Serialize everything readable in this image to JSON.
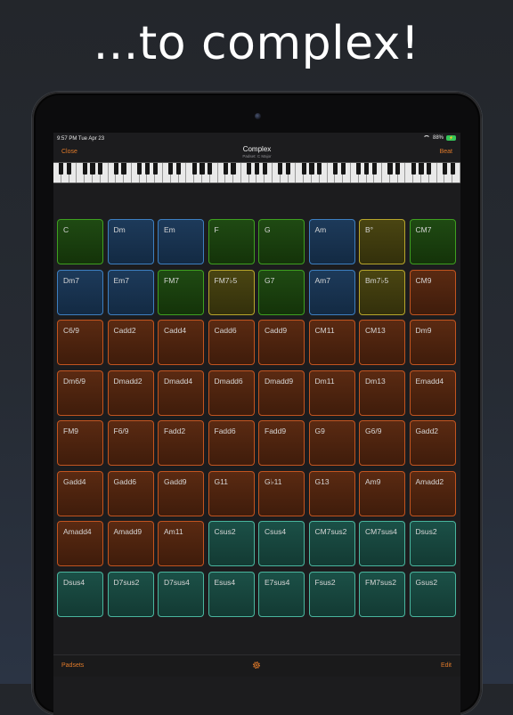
{
  "headline": "...to complex!",
  "status": {
    "time": "9:57 PM  Tue Apr 23",
    "battery": "88%"
  },
  "nav": {
    "left": "Close",
    "title": "Complex",
    "subtitle": "Padset: C Major",
    "right": "Beat"
  },
  "pads": [
    {
      "label": "C",
      "color": "green"
    },
    {
      "label": "Dm",
      "color": "blue"
    },
    {
      "label": "Em",
      "color": "blue"
    },
    {
      "label": "F",
      "color": "green"
    },
    {
      "label": "G",
      "color": "green"
    },
    {
      "label": "Am",
      "color": "blue"
    },
    {
      "label": "B°",
      "color": "yellow"
    },
    {
      "label": "CM7",
      "color": "green"
    },
    {
      "label": "Dm7",
      "color": "blue"
    },
    {
      "label": "Em7",
      "color": "blue"
    },
    {
      "label": "FM7",
      "color": "green"
    },
    {
      "label": "FM7♭5",
      "color": "yellow"
    },
    {
      "label": "G7",
      "color": "green"
    },
    {
      "label": "Am7",
      "color": "blue"
    },
    {
      "label": "Bm7♭5",
      "color": "yellow"
    },
    {
      "label": "CM9",
      "color": "orange"
    },
    {
      "label": "C6/9",
      "color": "orange"
    },
    {
      "label": "Cadd2",
      "color": "orange"
    },
    {
      "label": "Cadd4",
      "color": "orange"
    },
    {
      "label": "Cadd6",
      "color": "orange"
    },
    {
      "label": "Cadd9",
      "color": "orange"
    },
    {
      "label": "CM11",
      "color": "orange"
    },
    {
      "label": "CM13",
      "color": "orange"
    },
    {
      "label": "Dm9",
      "color": "orange"
    },
    {
      "label": "Dm6/9",
      "color": "orange"
    },
    {
      "label": "Dmadd2",
      "color": "orange"
    },
    {
      "label": "Dmadd4",
      "color": "orange"
    },
    {
      "label": "Dmadd6",
      "color": "orange"
    },
    {
      "label": "Dmadd9",
      "color": "orange"
    },
    {
      "label": "Dm11",
      "color": "orange"
    },
    {
      "label": "Dm13",
      "color": "orange"
    },
    {
      "label": "Emadd4",
      "color": "orange"
    },
    {
      "label": "FM9",
      "color": "orange"
    },
    {
      "label": "F6/9",
      "color": "orange"
    },
    {
      "label": "Fadd2",
      "color": "orange"
    },
    {
      "label": "Fadd6",
      "color": "orange"
    },
    {
      "label": "Fadd9",
      "color": "orange"
    },
    {
      "label": "G9",
      "color": "orange"
    },
    {
      "label": "G6/9",
      "color": "orange"
    },
    {
      "label": "Gadd2",
      "color": "orange"
    },
    {
      "label": "Gadd4",
      "color": "orange"
    },
    {
      "label": "Gadd6",
      "color": "orange"
    },
    {
      "label": "Gadd9",
      "color": "orange"
    },
    {
      "label": "G11",
      "color": "orange"
    },
    {
      "label": "G♭11",
      "color": "orange"
    },
    {
      "label": "G13",
      "color": "orange"
    },
    {
      "label": "Am9",
      "color": "orange"
    },
    {
      "label": "Amadd2",
      "color": "orange"
    },
    {
      "label": "Amadd4",
      "color": "orange"
    },
    {
      "label": "Amadd9",
      "color": "orange"
    },
    {
      "label": "Am11",
      "color": "orange"
    },
    {
      "label": "Csus2",
      "color": "teal"
    },
    {
      "label": "Csus4",
      "color": "teal"
    },
    {
      "label": "CM7sus2",
      "color": "teal"
    },
    {
      "label": "CM7sus4",
      "color": "teal"
    },
    {
      "label": "Dsus2",
      "color": "teal"
    },
    {
      "label": "Dsus4",
      "color": "teal"
    },
    {
      "label": "D7sus2",
      "color": "teal"
    },
    {
      "label": "D7sus4",
      "color": "teal"
    },
    {
      "label": "Esus4",
      "color": "teal"
    },
    {
      "label": "E7sus4",
      "color": "teal"
    },
    {
      "label": "Fsus2",
      "color": "teal"
    },
    {
      "label": "FM7sus2",
      "color": "teal"
    },
    {
      "label": "Gsus2",
      "color": "teal"
    }
  ],
  "bottom": {
    "left": "Padsets",
    "settings_icon": "gear-icon",
    "right": "Edit"
  },
  "colors": {
    "accent": "#e07a2a",
    "background": "#1c1c1e"
  }
}
